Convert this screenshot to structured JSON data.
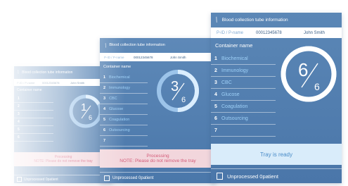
{
  "panel_back": {
    "header_title": "Blood collection tube information",
    "pid_label": "P-ID / P-name",
    "pid_value": "00012345678",
    "patient_name": "John Smith",
    "container_heading": "Container name",
    "rows": [
      {
        "num": "1",
        "label": ""
      },
      {
        "num": "2",
        "label": ""
      },
      {
        "num": "3",
        "label": ""
      },
      {
        "num": "4",
        "label": ""
      },
      {
        "num": "5",
        "label": ""
      },
      {
        "num": "6",
        "label": ""
      }
    ],
    "count_current": "1",
    "count_total": "6",
    "progress": 0.17,
    "status_line1": "Processing",
    "status_line2": "NOTE: Please do not remove the tray",
    "footer_label": "Unprocessed 0patient"
  },
  "panel_middle": {
    "header_title": "Blood collection tube information",
    "pid_label": "P-ID / P-name",
    "pid_value": "00012345678",
    "patient_name": "John Smith",
    "container_heading": "Container name",
    "rows": [
      {
        "num": "1",
        "label": "Biochemical"
      },
      {
        "num": "2",
        "label": "Immunology"
      },
      {
        "num": "3",
        "label": "CBC"
      },
      {
        "num": "4",
        "label": "Glucose"
      },
      {
        "num": "5",
        "label": "Coagulation"
      },
      {
        "num": "6",
        "label": "Outsourcing"
      },
      {
        "num": "7",
        "label": ""
      }
    ],
    "count_current": "3",
    "count_total": "6",
    "progress": 0.5,
    "status_line1": "Processing",
    "status_line2": "NOTE: Please do not remove the tray",
    "footer_label": "Unprocessed 0patient"
  },
  "panel_front": {
    "header_title": "Blood collection tube information",
    "pid_label": "P-ID / P-name",
    "pid_value": "00012345678",
    "patient_name": "John Smith",
    "container_heading": "Container name",
    "rows": [
      {
        "num": "1",
        "label": "Biochemical"
      },
      {
        "num": "2",
        "label": "Immunology"
      },
      {
        "num": "3",
        "label": "CBC"
      },
      {
        "num": "4",
        "label": "Glucose"
      },
      {
        "num": "5",
        "label": "Coagulation"
      },
      {
        "num": "6",
        "label": "Outsourcing"
      },
      {
        "num": "7",
        "label": ""
      }
    ],
    "count_current": "6",
    "count_total": "6",
    "progress": 1.0,
    "status_text": "Tray is ready",
    "footer_label": "Unprocessed 0patient"
  },
  "colors": {
    "panel_blue": "#4f7cae",
    "ring_track": "#9cc4ea",
    "ring_fill": "#dbeefe",
    "label_cyan": "#9ed0f7",
    "processing_bg": "#f2d6dc",
    "processing_text": "#d45a78",
    "ready_bg": "#d9ecfa",
    "ready_text": "#4a8cc8"
  }
}
